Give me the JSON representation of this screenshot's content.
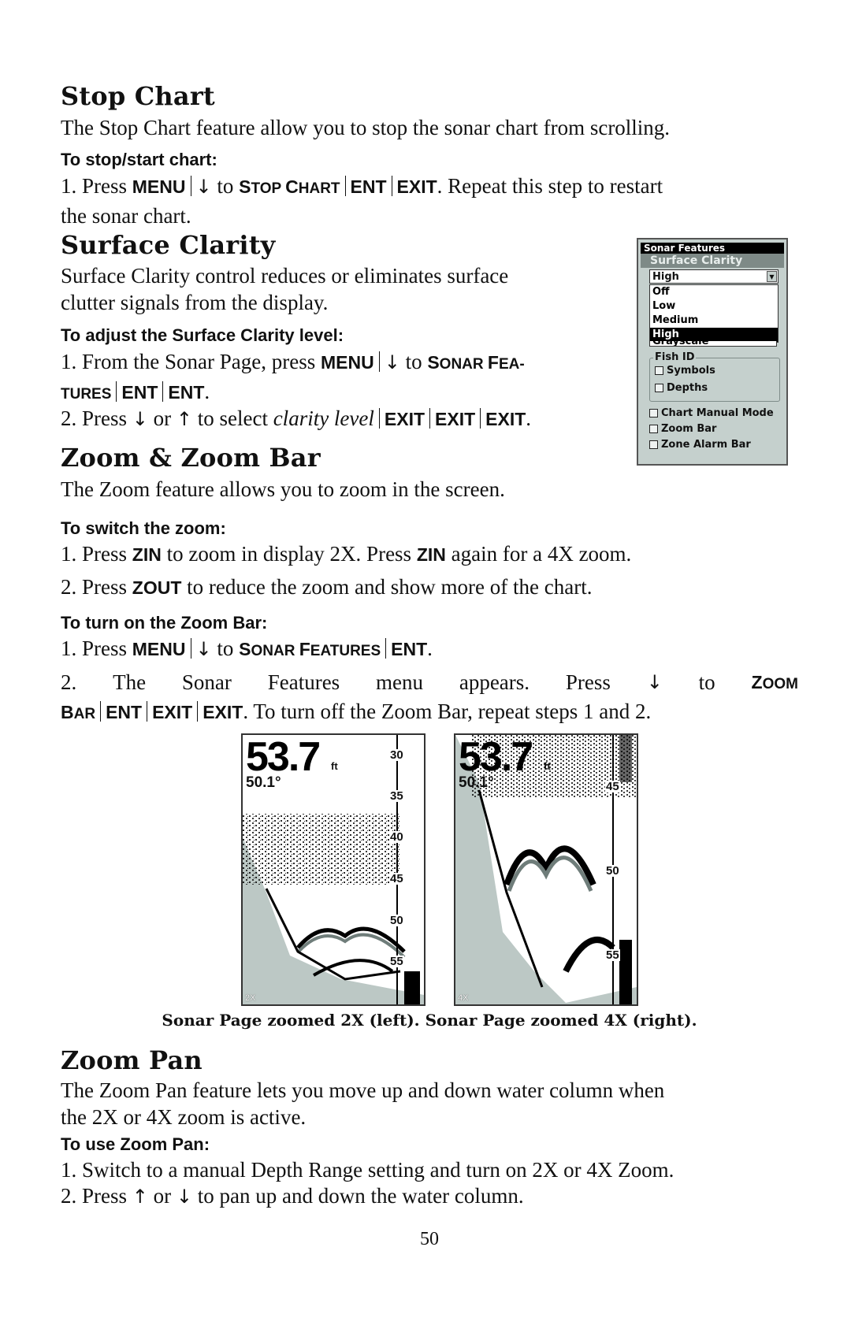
{
  "page_number": "50",
  "sections": {
    "stop_chart": {
      "heading": "Stop Chart",
      "intro": "The Stop Chart feature allow you to stop the sonar chart from scrolling.",
      "subheading": "To stop/start chart:",
      "step1": {
        "num": "1. Press",
        "key_menu": "MENU",
        "arrow": "↓",
        "to": "to",
        "item_s": "S",
        "item_top": "top",
        "item_c": "C",
        "item_hart": "hart",
        "key_ent": "ENT",
        "key_exit": "EXIT",
        "rest": ". Repeat this step to restart",
        "line2": "the sonar chart."
      }
    },
    "surface_clarity": {
      "heading": "Surface Clarity",
      "intro_line1": "Surface Clarity control reduces or eliminates surface",
      "intro_line2": "clutter signals from the display.",
      "subheading": "To adjust the Surface Clarity level:",
      "step1": {
        "num": "1. From the Sonar Page, press",
        "key_menu": "MENU",
        "arrow": "↓",
        "to": "to",
        "item_s": "S",
        "item_onar": "onar",
        "item_f": "F",
        "item_ea": "ea-",
        "line2_tures": "tures",
        "key_ent1": "ENT",
        "key_ent2": "ENT",
        "period": "."
      },
      "step2": {
        "num": "2. Press",
        "arrow_down": "↓",
        "or": "or",
        "arrow_up": "↑",
        "to_select": "to select",
        "italic": "clarity level",
        "key_exit1": "EXIT",
        "key_exit2": "EXIT",
        "key_exit3": "EXIT",
        "period": "."
      }
    },
    "zoom": {
      "heading": "Zoom & Zoom Bar",
      "intro": "The Zoom feature allows you to zoom in the screen.",
      "subheading_switch": "To switch the zoom:",
      "switch_step1": {
        "a": "1. Press",
        "key_zin": "ZIN",
        "b": "to zoom in display 2X. Press",
        "key_zin2": "ZIN",
        "c": "again for a 4X zoom."
      },
      "switch_step2": {
        "a": "2. Press",
        "key_zout": "ZOUT",
        "b": "to reduce the zoom and show more of the chart."
      },
      "subheading_bar": "To turn on the Zoom Bar:",
      "bar_step1": {
        "a": "1. Press",
        "key_menu": "MENU",
        "arrow": "↓",
        "to": "to",
        "s": "S",
        "onar": "onar",
        "f": "F",
        "eatures": "eatures",
        "key_ent": "ENT",
        "period": "."
      },
      "bar_step2": {
        "a": "2. The Sonar Features menu appears. Press",
        "arrow": "↓",
        "to": "to",
        "z": "Z",
        "oom": "oom",
        "b": "B",
        "ar": "ar",
        "key_ent": "ENT",
        "key_exit1": "EXIT",
        "key_exit2": "EXIT",
        "rest": ". To turn off the Zoom Bar, repeat steps 1 and 2."
      },
      "figure_caption": "Sonar Page zoomed 2X (left). Sonar Page zoomed 4X (right)."
    },
    "zoom_pan": {
      "heading": "Zoom Pan",
      "intro_line1": "The Zoom Pan feature lets you move up and down water column when",
      "intro_line2": "the 2X or 4X zoom is active.",
      "subheading": "To use Zoom Pan:",
      "step1": "1. Switch to a manual Depth Range setting and turn on 2X or 4X Zoom.",
      "step2": {
        "a": "2. Press",
        "arrow_up": "↑",
        "or": "or",
        "arrow_down": "↓",
        "b": "to pan up and down the water column."
      }
    }
  },
  "sonar_features_menu": {
    "title": "Sonar Features",
    "surface_clarity_label": "Surface Clarity",
    "selected_value": "High",
    "options": [
      "Off",
      "Low",
      "Medium",
      "High"
    ],
    "selected_option": "High",
    "hidden_item_peek": "Grayscale",
    "fish_id_group": "Fish ID",
    "fish_id_options": [
      {
        "label": "Symbols",
        "checked": false
      },
      {
        "label": "Depths",
        "checked": false
      }
    ],
    "checkboxes": [
      {
        "label": "Chart Manual Mode",
        "checked": false
      },
      {
        "label": "Zoom Bar",
        "checked": false
      },
      {
        "label": "Zone Alarm Bar",
        "checked": false
      }
    ],
    "colors": {
      "background": "#c5d0cd",
      "title_bar": "#000000",
      "section_bar": "#7e8a87",
      "selection": "#000000"
    }
  },
  "sonar_screens": [
    {
      "zoom_label": "2X",
      "depth": "53.7",
      "depth_unit": "ft",
      "temperature": "50.1°",
      "scale_labels": [
        "30",
        "35",
        "40",
        "45",
        "50",
        "55"
      ]
    },
    {
      "zoom_label": "4X",
      "depth": "53.7",
      "depth_unit": "ft",
      "temperature": "50.1°",
      "scale_labels": [
        "45",
        "50",
        "55"
      ]
    }
  ]
}
